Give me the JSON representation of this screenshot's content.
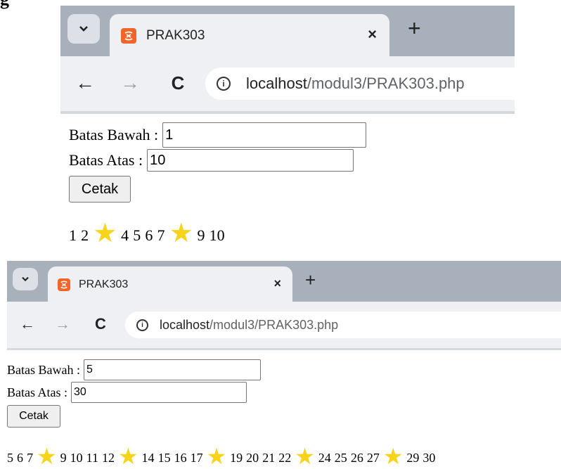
{
  "partial_label": "g",
  "screenshots": [
    {
      "tab_title": "PRAK303",
      "tab_close": "×",
      "new_tab": "+",
      "nav_back": "←",
      "nav_forward": "→",
      "nav_reload": "C",
      "url_host": "localhost",
      "url_path": "/modul3/PRAK303.php",
      "form": {
        "lower_label": "Batas Bawah :",
        "lower_value": "1",
        "upper_label": "Batas Atas :",
        "upper_value": "10",
        "submit_label": "Cetak"
      },
      "result": [
        "1",
        "2",
        "★",
        "4",
        "5",
        "6",
        "7",
        "★",
        "9",
        "10"
      ]
    },
    {
      "tab_title": "PRAK303",
      "tab_close": "×",
      "new_tab": "+",
      "nav_back": "←",
      "nav_forward": "→",
      "nav_reload": "C",
      "url_host": "localhost",
      "url_path": "/modul3/PRAK303.php",
      "form": {
        "lower_label": "Batas Bawah :",
        "lower_value": "5",
        "upper_label": "Batas Atas :",
        "upper_value": "30",
        "submit_label": "Cetak"
      },
      "result": [
        "5",
        "6",
        "7",
        "★",
        "9",
        "10",
        "11",
        "12",
        "★",
        "14",
        "15",
        "16",
        "17",
        "★",
        "19",
        "20",
        "21",
        "22",
        "★",
        "24",
        "25",
        "26",
        "27",
        "★",
        "29",
        "30"
      ]
    }
  ],
  "icons": {
    "tab_menu": "chevron-down-icon",
    "favicon": "xampp-icon",
    "info": "info-icon",
    "star": "star-icon"
  },
  "colors": {
    "tabstrip": "#a8b0bc",
    "toolbar": "#eef0f3",
    "favicon": "#f0662a",
    "star": "#f7d31a"
  }
}
